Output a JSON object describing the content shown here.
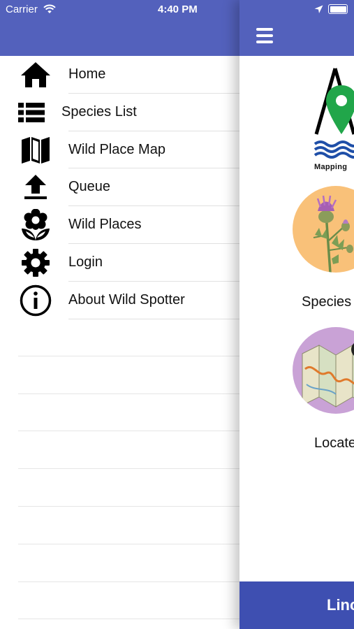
{
  "status_bar": {
    "carrier": "Carrier",
    "time": "4:40 PM"
  },
  "drawer": {
    "items": [
      {
        "label": "Home",
        "icon": "home-icon"
      },
      {
        "label": "Species List",
        "icon": "list-icon"
      },
      {
        "label": "Wild Place Map",
        "icon": "map-icon"
      },
      {
        "label": "Queue",
        "icon": "upload-icon"
      },
      {
        "label": "Wild Places",
        "icon": "flower-icon"
      },
      {
        "label": "Login",
        "icon": "gear-icon"
      },
      {
        "label": "About Wild Spotter",
        "icon": "info-icon"
      }
    ]
  },
  "main": {
    "logo_caption": "Mapping",
    "species_label": "Species",
    "locate_label": "Locate",
    "bottom_button_label": "Linc"
  },
  "colors": {
    "nav_bar": "#5361bc",
    "bottom_button": "#3e4fb1",
    "species_circle": "#f9c179",
    "locate_circle": "#c9a2d6",
    "logo_pin": "#21a64a",
    "logo_waves": "#1f4fa8"
  }
}
